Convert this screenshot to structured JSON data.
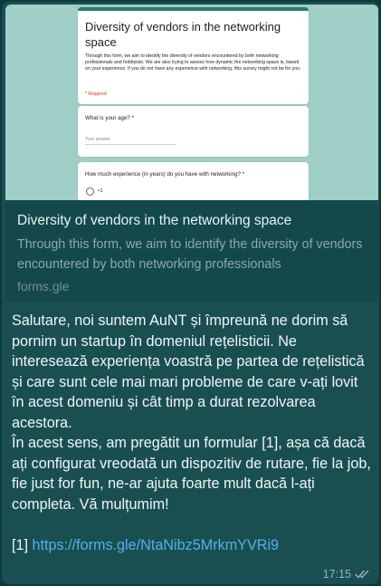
{
  "form": {
    "title": "Diversity of vendors in the networking space",
    "description": "Through this form, we aim to identify the diversity of vendors encountered by both networking professionals and hobbyists. We are also trying to assess how dynamic the networking space is, based on your experience. If you do not have any experience with networking, this survey might not be for you.",
    "required_note": "* Required",
    "questions": [
      {
        "label": "What is your age? *",
        "placeholder": "Your answer"
      },
      {
        "label": "How much experience (in years) do you have with networking? *",
        "first_option": "<1"
      }
    ]
  },
  "link_preview": {
    "title": "Diversity of vendors in the networking space",
    "description": "Through this form, we aim to identify the diversity of vendors encountered by both networking professionals",
    "domain": "forms.gle"
  },
  "message": {
    "paragraph1": "Salutare, noi suntem AuNT și împreună ne dorim să pornim un startup în domeniul rețelisticii. Ne interesează experiența voastră pe partea de rețelistică și care sunt cele mai mari probleme de care v-ați lovit în acest domeniu și cât timp a durat rezolvarea acestora.",
    "paragraph2": "În acest sens, am pregătit un formular [1], așa că dacă ați configurat vreodată un dispozitiv de rutare, fie la job, fie just for fun, ne-ar ajuta foarte mult dacă l-ați completa. Vă mulțumim!",
    "ref_marker": "[1]",
    "ref_url": "https://forms.gle/NtaNibz5MrkmYVRi9"
  },
  "meta": {
    "time": "17:15",
    "status_icon": "double-check-icon"
  },
  "colors": {
    "bubble": "#1a4f52",
    "link": "#4fb3e6",
    "preview_image_bg": "#9fcfc6"
  }
}
